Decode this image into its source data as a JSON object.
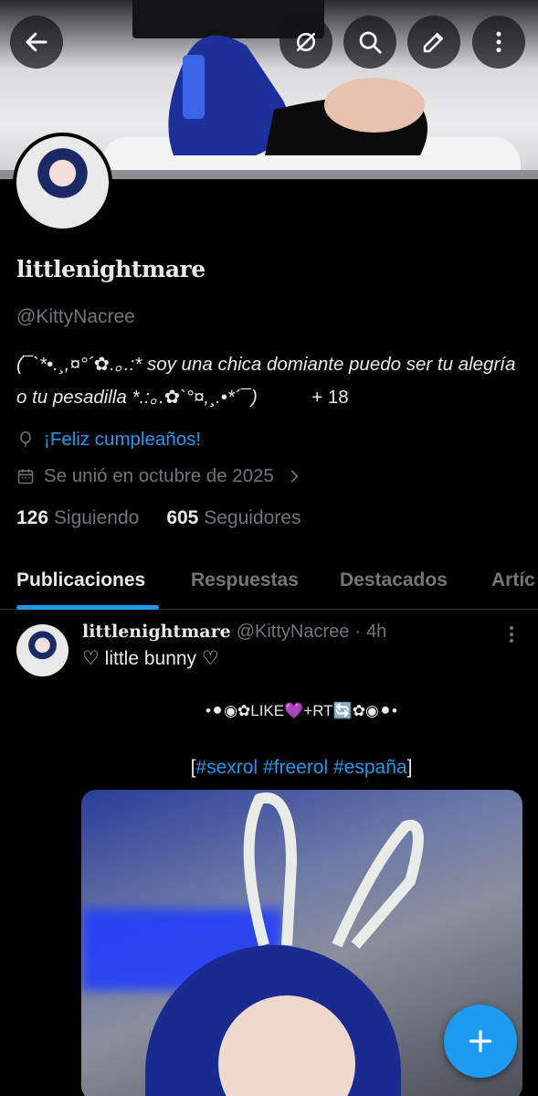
{
  "header": {
    "back_icon": "arrow-left-icon",
    "actions": [
      "no-sound-icon",
      "search-icon",
      "edit-icon",
      "more-vertical-icon"
    ]
  },
  "profile": {
    "display_name": "littlenightmare",
    "handle": "@KittyNacree",
    "bio_text": "(¯`*•.¸,¤°´✿.｡.:* soy una chica domiante puedo ser tu alegría o tu pesadilla *.:｡.✿`°¤,¸.•*´¯)",
    "bio_age": "+ 18",
    "birthday": "¡Feliz cumpleaños!",
    "joined": "Se unió en octubre de 2025",
    "following_count": "126",
    "following_label": "Siguiendo",
    "followers_count": "605",
    "followers_label": "Seguidores"
  },
  "tabs": [
    {
      "label": "Publicaciones",
      "active": true
    },
    {
      "label": "Respuestas",
      "active": false
    },
    {
      "label": "Destacados",
      "active": false
    },
    {
      "label": "Artíc",
      "active": false
    }
  ],
  "post": {
    "author_name": "littlenightmare",
    "author_handle": "@KittyNacree",
    "separator": "·",
    "time": "4h",
    "line1": "♡ little bunny ♡",
    "deco": "•⚫◉✿LIKE💜+RT🔄✿◉⚫•",
    "tags_open": "[",
    "tags": [
      "#sexrol",
      "#freerol",
      "#españa"
    ],
    "tags_close": "]"
  },
  "colors": {
    "accent": "#1d9bf0",
    "muted": "#71767b",
    "text": "#e7e9ea",
    "background": "#000000"
  }
}
